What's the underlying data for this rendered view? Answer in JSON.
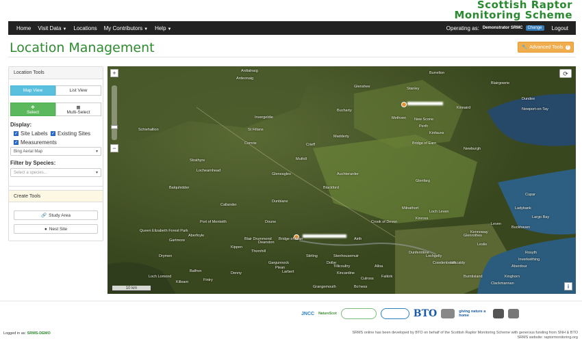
{
  "brand": {
    "line1": "Scottish Raptor",
    "line2": "Monitoring Scheme"
  },
  "nav": {
    "home": "Home",
    "visit_data": "Visit Data",
    "locations": "Locations",
    "my_contributors": "My Contributors",
    "help": "Help",
    "operating_as_label": "Operating as:",
    "operating_as_user": "Demonstrator SRMC",
    "change": "Change",
    "logout": "Logout"
  },
  "page": {
    "title": "Location Management",
    "advanced_tools": "Advanced Tools"
  },
  "location_tools": {
    "heading": "Location Tools",
    "map_view": "Map View",
    "list_view": "List View",
    "select": "Select",
    "multi_select": "Multi-Select",
    "display_label": "Display:",
    "site_labels": "Site Labels",
    "existing_sites": "Existing Sites",
    "measurements": "Measurements",
    "basemap": "Bing Aerial Map",
    "filter_label": "Filter by Species:",
    "species_placeholder": "Select a species..."
  },
  "create_tools": {
    "heading": "Create Tools",
    "study_area": "Study Area",
    "nest_site": "Nest Site"
  },
  "map": {
    "scale": "10 km",
    "places": [
      "Ardtalnaig",
      "Ardeonaig",
      "Glenshee",
      "Burrelton",
      "Stanley",
      "Dundee",
      "Blairgowrie",
      "Bucharty",
      "Invergeldie",
      "Methven",
      "Kinnaird",
      "Newport-on-Tay",
      "St Fillans",
      "Comrie",
      "Perth",
      "New Scone",
      "Kinfauns",
      "Schiehallion",
      "Madderty",
      "Crieff",
      "Muthill",
      "Bridge of Earn",
      "Newburgh",
      "Strathyre",
      "Auchterarder",
      "Blackford",
      "Glenfarg",
      "Gleneagles",
      "Lochearnhead",
      "Balquhidder",
      "Callander",
      "Doune",
      "Dunblane",
      "Port of Menteith",
      "Aberfoyle",
      "Crook of Devon",
      "Milnathort",
      "Kinross",
      "Loch Leven",
      "Stirling",
      "Alloa",
      "Dollar",
      "Bridge of Allan",
      "Tillicoultry",
      "Falkirk",
      "Kincardine",
      "Culross",
      "Dunfermline",
      "Glenrothes",
      "Leslie",
      "Cupar",
      "Ladybank",
      "Kennoway",
      "Leven",
      "Buckhaven",
      "Largo Bay",
      "Burntisland",
      "Kirkcaldy",
      "Cowdenbeath",
      "Lochgelly",
      "Gartmore",
      "Drymen",
      "Balfron",
      "Killearn",
      "Fintry",
      "Denny",
      "Grangemouth",
      "Bo'ness",
      "Queen Elizabeth Forest Park",
      "Loch Lomond",
      "Kippen",
      "Thornhill",
      "Blair Drummond",
      "Deanston",
      "Gargunnock",
      "Plean",
      "Larbert",
      "Stenhousemuir",
      "Airth",
      "Clackmannan",
      "Kinghorn",
      "Aberdour",
      "Inverkeithing",
      "Rosyth"
    ]
  },
  "footer": {
    "logged_in_label": "Logged in as:",
    "logged_in_user": "SRMS-DEMO",
    "credit_line1": "SRMS online has been developed by BTO on behalf of the Scottish Raptor Monitoring Scheme with generous funding from SNH & BTO",
    "credit_line2": "SRMS website: raptormonitoring.org",
    "logos": [
      "JNCC",
      "NatureScot",
      "BTO",
      "giving nature a home"
    ]
  }
}
